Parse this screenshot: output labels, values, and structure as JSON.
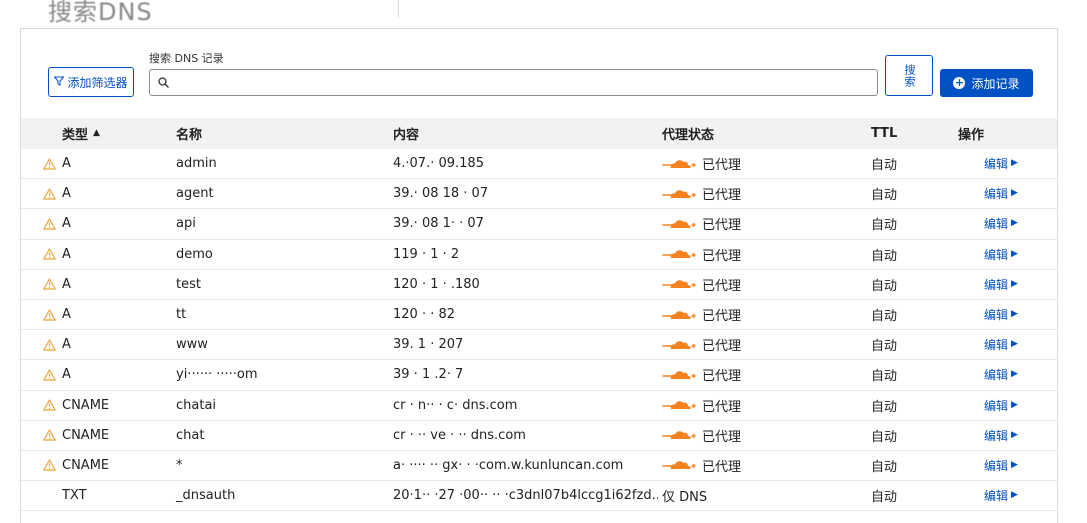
{
  "header": {
    "title": "搜索DNS"
  },
  "toolbar": {
    "filter_label": "添加筛选器",
    "search_label": "搜索 DNS 记录",
    "search_value": "",
    "search_button": "搜索",
    "add_label": "添加记录"
  },
  "table": {
    "columns": [
      "类型",
      "名称",
      "内容",
      "代理状态",
      "TTL",
      "操作"
    ],
    "rows": [
      {
        "warn": true,
        "type": "A",
        "name": "admin",
        "content": "4.·07.· 09.185",
        "proxy": "已代理",
        "ttl": "自动",
        "action": "编辑"
      },
      {
        "warn": true,
        "type": "A",
        "name": "agent",
        "content": "39.· 08 18 · 07",
        "proxy": "已代理",
        "ttl": "自动",
        "action": "编辑"
      },
      {
        "warn": true,
        "type": "A",
        "name": "api",
        "content": "39.· 08 1· · 07",
        "proxy": "已代理",
        "ttl": "自动",
        "action": "编辑"
      },
      {
        "warn": true,
        "type": "A",
        "name": "demo",
        "content": "119 · 1 ·  2",
        "proxy": "已代理",
        "ttl": "自动",
        "action": "编辑"
      },
      {
        "warn": true,
        "type": "A",
        "name": "test",
        "content": "120 ·  1 · .180",
        "proxy": "已代理",
        "ttl": "自动",
        "action": "编辑"
      },
      {
        "warn": true,
        "type": "A",
        "name": "tt",
        "content": "120 ·  · 82",
        "proxy": "已代理",
        "ttl": "自动",
        "action": "编辑"
      },
      {
        "warn": true,
        "type": "A",
        "name": "www",
        "content": "39.  1 · 207",
        "proxy": "已代理",
        "ttl": "自动",
        "action": "编辑"
      },
      {
        "warn": true,
        "type": "A",
        "name": "yi······ ·····om",
        "content": "39 ·  1 .2· 7",
        "proxy": "已代理",
        "ttl": "自动",
        "action": "编辑"
      },
      {
        "warn": true,
        "type": "CNAME",
        "name": "chatai",
        "content": "cr ·  n·· · c· dns.com",
        "proxy": "已代理",
        "ttl": "自动",
        "action": "编辑"
      },
      {
        "warn": true,
        "type": "CNAME",
        "name": "chat",
        "content": "cr ·  ·· ve · ·· dns.com",
        "proxy": "已代理",
        "ttl": "自动",
        "action": "编辑"
      },
      {
        "warn": true,
        "type": "CNAME",
        "name": "*",
        "content": "a·  ···· ·· gx· · ·com.w.kunluncan.com",
        "proxy": "已代理",
        "ttl": "自动",
        "action": "编辑"
      },
      {
        "warn": false,
        "type": "TXT",
        "name": "_dnsauth",
        "content": "20·1·· ·27 ·00·· ·· ·c3dnl07b4lccg1i62fzd...",
        "proxy": "仅 DNS",
        "ttl": "自动",
        "action": "编辑"
      }
    ]
  },
  "colors": {
    "accent": "#0051c3",
    "warning": "#e8a33d",
    "cloud": "#f6821f"
  },
  "icons": {
    "filter": "filter-icon",
    "search": "search-icon",
    "add": "plus-circle-icon",
    "warning": "warning-icon",
    "cloud": "cloudflare-proxy-icon",
    "sort": "sort-ascending-icon",
    "action_caret": "caret-right-icon"
  }
}
